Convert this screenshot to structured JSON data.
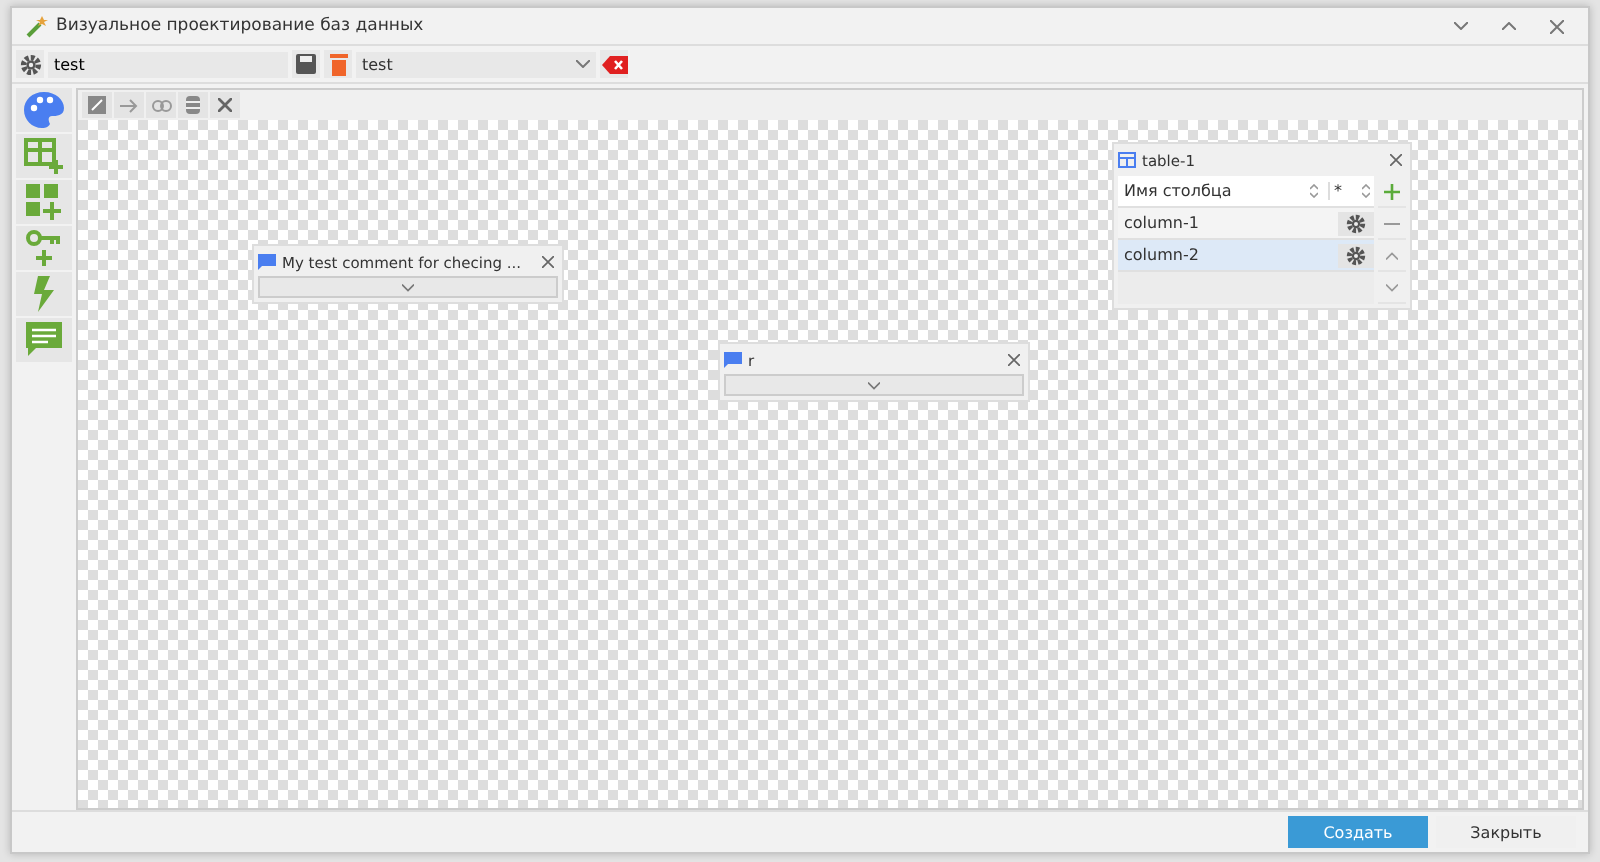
{
  "window": {
    "title": "Визуальное проектирование баз данных"
  },
  "toolbar": {
    "name_value": "test",
    "schema_value": "test"
  },
  "palette": [
    {
      "kind": "palette"
    },
    {
      "kind": "table"
    },
    {
      "kind": "group"
    },
    {
      "kind": "key"
    },
    {
      "kind": "bolt"
    },
    {
      "kind": "comment"
    }
  ],
  "canvas_tools": [
    {
      "kind": "edit"
    },
    {
      "kind": "arrow"
    },
    {
      "kind": "link"
    },
    {
      "kind": "database"
    },
    {
      "kind": "close"
    }
  ],
  "comments": [
    {
      "text": "My test comment for checing ..."
    },
    {
      "text": "r"
    }
  ],
  "table": {
    "title": "table-1",
    "header": "Имя столбца",
    "header_mark": "*",
    "rows": [
      {
        "name": "column-1",
        "selected": false
      },
      {
        "name": "column-2",
        "selected": true
      }
    ]
  },
  "buttons": [
    {
      "label": "Создать",
      "kind": "primary"
    },
    {
      "label": "Закрыть",
      "kind": "plain"
    }
  ]
}
